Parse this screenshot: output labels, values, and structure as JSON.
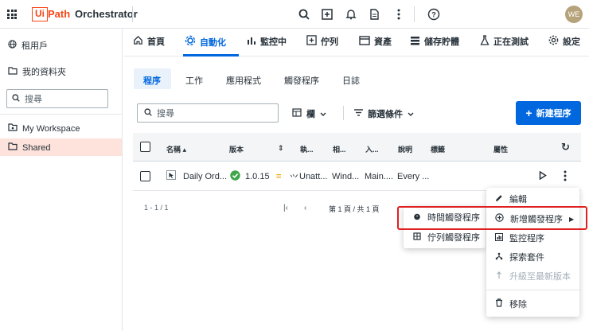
{
  "header": {
    "brand_ui": "Ui",
    "brand_path": "Path",
    "product": "Orchestrator",
    "avatar": "WE",
    "icons": [
      "search-icon",
      "add-box-icon",
      "bell-icon",
      "document-icon",
      "more-icon",
      "help-icon"
    ]
  },
  "sidebar": {
    "tenant": "租用戶",
    "my_folders": "我的資料夾",
    "search_placeholder": "搜尋",
    "items": [
      {
        "label": "My Workspace"
      },
      {
        "label": "Shared"
      }
    ]
  },
  "nav": {
    "items": [
      {
        "label": "首頁"
      },
      {
        "label": "自動化"
      },
      {
        "label": "監控中"
      },
      {
        "label": "佇列"
      },
      {
        "label": "資產"
      },
      {
        "label": "儲存貯體"
      },
      {
        "label": "正在測試"
      },
      {
        "label": "設定"
      }
    ]
  },
  "subtabs": [
    "程序",
    "工作",
    "應用程式",
    "觸發程序",
    "日誌"
  ],
  "toolbar": {
    "search_placeholder": "搜尋",
    "columns_label": "欄",
    "filters_label": "篩選條件",
    "new_process_label": "新建程序"
  },
  "table": {
    "headers": [
      "名稱",
      "版本",
      "執...",
      "相...",
      "入...",
      "說明",
      "標籤",
      "屬性"
    ],
    "rows": [
      {
        "name": "Daily Ord...",
        "version": "1.0.15",
        "exec": "Unatt...",
        "rel": "Wind...",
        "entry": "Main....",
        "desc": "Every ..."
      }
    ]
  },
  "pagination": {
    "range": "1 - 1 / 1",
    "page": "第 1 頁 / 共 1 頁"
  },
  "context_menu": {
    "items": [
      "編輯",
      "新增觸發程序",
      "監控程序",
      "探索套件",
      "升級至最新版本",
      "移除"
    ]
  },
  "submenu": {
    "items": [
      "時間觸發程序",
      "佇列觸發程序"
    ]
  },
  "colors": {
    "accent": "#0067df",
    "brand": "#fa4616",
    "highlight": "#e02020"
  }
}
